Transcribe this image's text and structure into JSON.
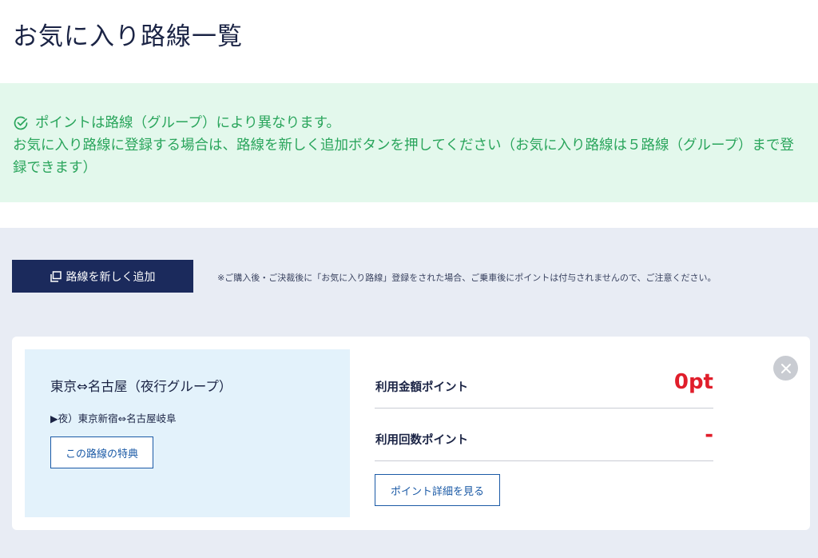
{
  "page": {
    "title": "お気に入り路線一覧"
  },
  "notice": {
    "icon": "check-circle-icon",
    "line1": "ポイントは路線（グループ）により異なります。",
    "line2": "お気に入り路線に登録する場合は、路線を新しく追加ボタンを押してください（お気に入り路線は５路線（グループ）まで登録できます）",
    "color": "#2aa55c",
    "background": "#e3f8ec"
  },
  "toolbar": {
    "add_route_label": "路線を新しく追加",
    "add_route_icon": "add-window-icon",
    "caution": "※ご購入後・ご決裁後に「お気に入り路線」登録をされた場合、ご乗車後にポイントは付与されませんので、ご注意ください。"
  },
  "favorite": {
    "route_name": "東京⇔名古屋（夜行グループ）",
    "route_detail": "▶夜）東京新宿⇔名古屋岐阜",
    "benefit_button": "この路線の特典",
    "points": [
      {
        "label": "利用金額ポイント",
        "value": "0pt"
      },
      {
        "label": "利用回数ポイント",
        "value": "-"
      }
    ],
    "detail_button": "ポイント詳細を見る",
    "close_icon": "close-icon"
  },
  "colors": {
    "accent_navy": "#1b2a5c",
    "point_red": "#e01e2b",
    "link_blue": "#1b5aa6"
  }
}
